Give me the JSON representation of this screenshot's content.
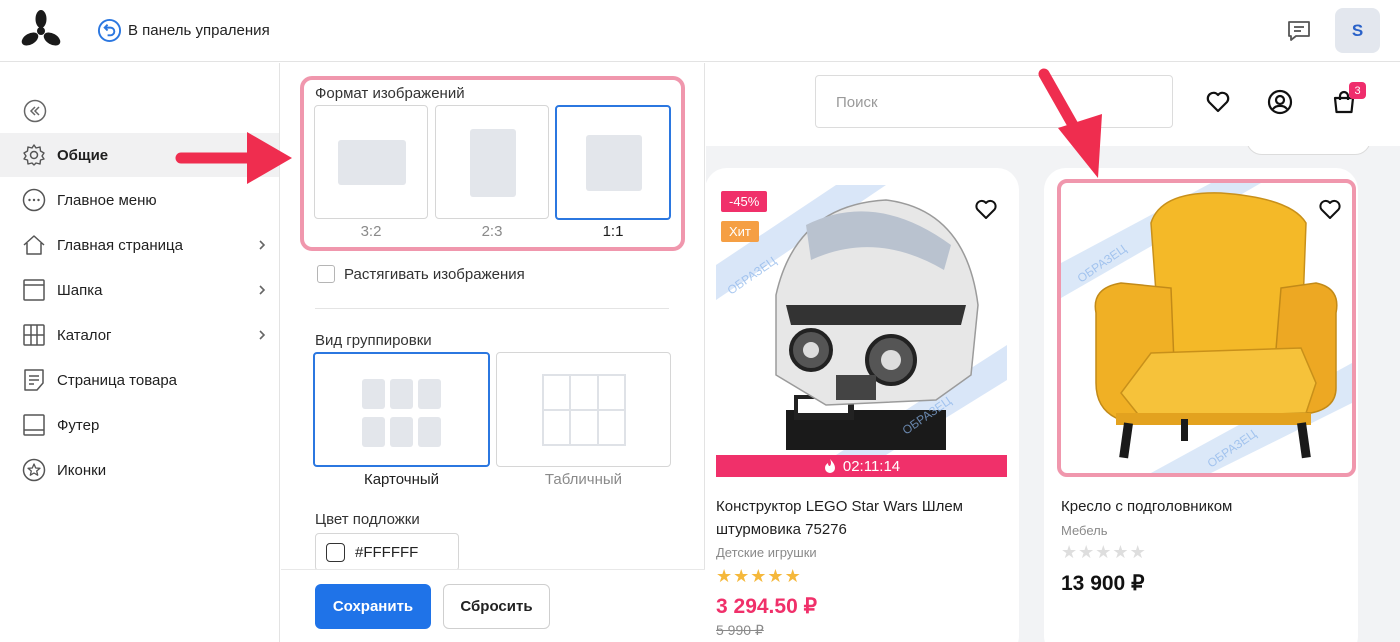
{
  "topbar": {
    "back_label": "В панель упраления",
    "avatar_letter": "S"
  },
  "sidebar": {
    "items": [
      {
        "label": "Общие",
        "icon": "gear-icon"
      },
      {
        "label": "Главное меню",
        "icon": "dots-circle-icon"
      },
      {
        "label": "Главная страница",
        "icon": "home-icon"
      },
      {
        "label": "Шапка",
        "icon": "header-layout-icon"
      },
      {
        "label": "Каталог",
        "icon": "grid-icon"
      },
      {
        "label": "Страница товара",
        "icon": "document-icon"
      },
      {
        "label": "Футер",
        "icon": "footer-layout-icon"
      },
      {
        "label": "Иконки",
        "icon": "star-circle-icon"
      }
    ]
  },
  "settings": {
    "image_format_label": "Формат изображений",
    "formats": [
      "3:2",
      "2:3",
      "1:1"
    ],
    "selected_format": "1:1",
    "stretch_label": "Растягивать изображения",
    "stretch_checked": false,
    "grouping_label": "Вид группировки",
    "groupings": [
      "Карточный",
      "Табличный"
    ],
    "selected_grouping": "Карточный",
    "bg_color_label": "Цвет подложки",
    "bg_color_value": "#FFFFFF",
    "save_label": "Сохранить",
    "reset_label": "Сбросить"
  },
  "preview": {
    "search_placeholder": "Поиск",
    "cart_count": "3",
    "products": [
      {
        "discount": "-45%",
        "badge": "Хит",
        "timer": "02:11:14",
        "title_line1": "Конструктор LEGO Star Wars Шлем",
        "title_line2": "штурмовика 75276",
        "category": "Детские игрушки",
        "rating": 5,
        "price": "3 294.50 ₽",
        "old_price": "5 990 ₽",
        "watermark": "ОБРАЗЕЦ"
      },
      {
        "title_line1": "Кресло с подголовником",
        "category": "Мебель",
        "rating": 0,
        "price": "13 900 ₽",
        "watermark": "ОБРАЗЕЦ"
      }
    ]
  },
  "colors": {
    "accent": "#1f73e8",
    "highlight": "#f097ad",
    "annotation_arrow": "#ef2d4f",
    "sale": "#f0306a",
    "star": "#f5b83b"
  }
}
